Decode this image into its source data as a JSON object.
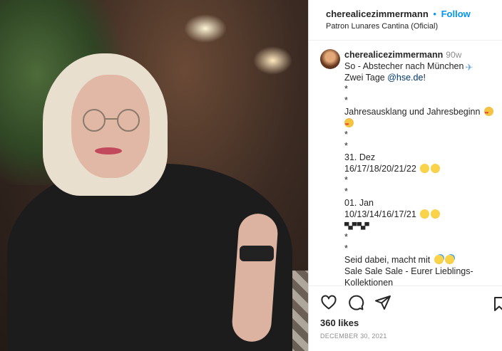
{
  "post": {
    "image_alt": "photo"
  },
  "header": {
    "username": "cherealicezimmermann",
    "separator": "•",
    "follow_label": "Follow",
    "location": "Patron Lunares Cantina (Oficial)"
  },
  "caption": {
    "username": "cherealicezimmermann",
    "age": "90w",
    "lines": {
      "l1": "So - Abstecher nach München",
      "l2_prefix": "Zwei Tage ",
      "l2_link": "@hse.de",
      "l2_suffix": "!",
      "l3": "*",
      "l4": "*",
      "l5": "Jahresausklang und Jahresbeginn",
      "l6": "*",
      "l7": "*",
      "l8": "31. Dez",
      "l9": "16/17/18/20/21/22",
      "l10": "*",
      "l11": "*",
      "l12": "01. Jan",
      "l13": "10/13/14/16/17/21",
      "l14": "▀▄▀ ▀▄▀",
      "l15": "*",
      "l16": "*",
      "l17": "Seid dabei, macht mit",
      "l18": "Sale Sale Sale - Eurer Lieblings-",
      "l19": "Kollektionen"
    }
  },
  "icons": {
    "like": "heart-icon",
    "comment": "comment-icon",
    "share": "share-icon",
    "save": "bookmark-icon"
  },
  "stats": {
    "likes": "360 likes",
    "date": "December 30, 2021"
  },
  "colors": {
    "accent": "#0095f6",
    "link": "#00376b",
    "muted": "#8e8e8e"
  }
}
